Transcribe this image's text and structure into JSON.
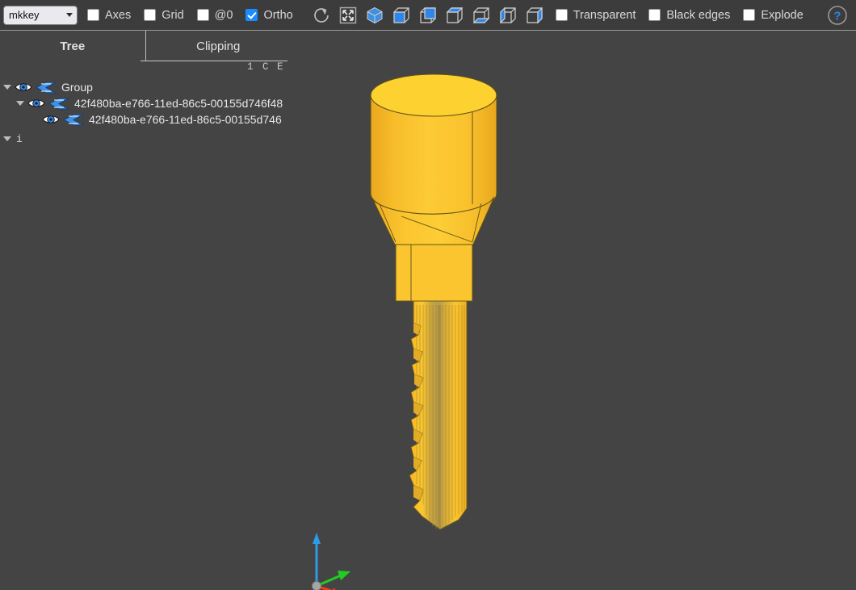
{
  "toolbar": {
    "model_select": {
      "value": "mkkey",
      "options": [
        "mkkey"
      ]
    },
    "checkboxes": [
      {
        "label": "Axes",
        "checked": false
      },
      {
        "label": "Grid",
        "checked": false
      },
      {
        "label": "@0",
        "checked": false
      },
      {
        "label": "Ortho",
        "checked": true
      }
    ],
    "icons": [
      "reset-view-icon",
      "fit-to-screen-icon",
      "isometric-view-icon",
      "front-view-icon",
      "rear-view-icon",
      "top-view-icon",
      "bottom-view-icon",
      "left-view-icon",
      "right-view-icon"
    ],
    "right_checkboxes": [
      {
        "label": "Transparent",
        "checked": false
      },
      {
        "label": "Black edges",
        "checked": false
      },
      {
        "label": "Explode",
        "checked": false
      }
    ],
    "help_label": "?"
  },
  "panel": {
    "tabs": [
      {
        "label": "Tree",
        "active": true
      },
      {
        "label": "Clipping",
        "active": false
      }
    ],
    "column_headers": [
      "1",
      "C",
      "E"
    ],
    "tree": [
      {
        "label": "Group",
        "depth": 0,
        "expanded": true,
        "visible": true,
        "mono": false
      },
      {
        "label": "42f480ba-e766-11ed-86c5-00155d746f48",
        "depth": 1,
        "expanded": true,
        "visible": true,
        "mono": false
      },
      {
        "label": "42f480ba-e766-11ed-86c5-00155d746",
        "depth": 2,
        "expanded": false,
        "visible": true,
        "mono": false
      },
      {
        "label": "i",
        "depth": 0,
        "expanded": true,
        "visible": false,
        "mono": true
      }
    ]
  },
  "viewport": {
    "background_color": "#444444",
    "model_name": "mkkey",
    "model_color": "#fac02b",
    "model_top_color": "#fdd130",
    "model_edge_color": "#6b5a1d",
    "axis_gizmo": {
      "x_label": "x",
      "x_color": "#ff3b10",
      "y_label": "y",
      "y_color": "#22cc22",
      "z_label": "z",
      "z_color": "#2f9ae8",
      "origin_color": "#9a9a9a"
    }
  }
}
